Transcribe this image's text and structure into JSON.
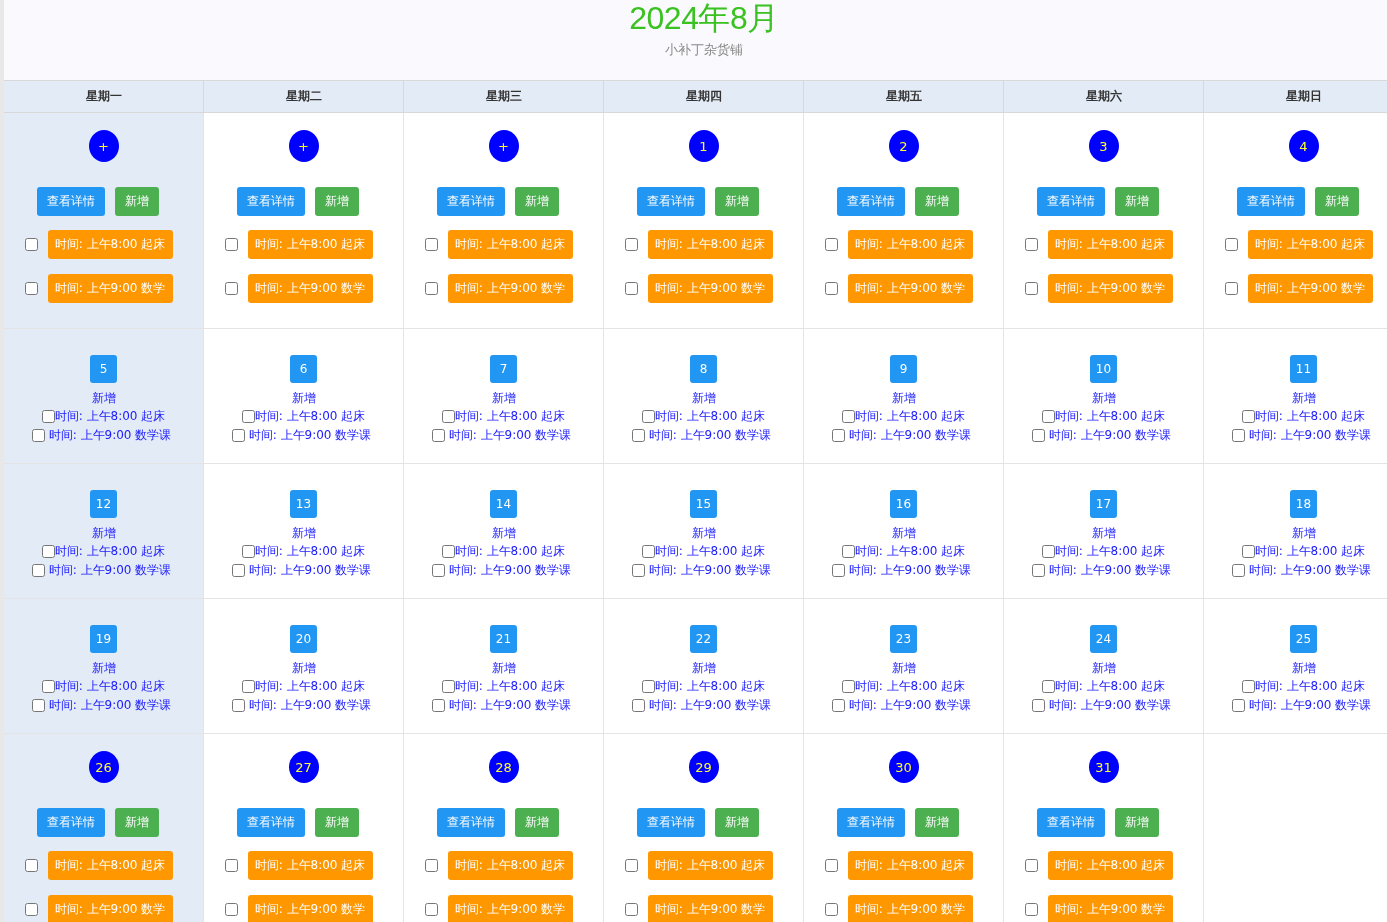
{
  "header": {
    "title": "2024年8月",
    "subtitle": "小补丁杂货铺"
  },
  "weekdays": [
    {
      "label": "星期一"
    },
    {
      "label": "星期二"
    },
    {
      "label": "星期三"
    },
    {
      "label": "星期四"
    },
    {
      "label": "星期五"
    },
    {
      "label": "星期六"
    },
    {
      "label": "星期日"
    }
  ],
  "weeks": [
    {
      "days": [
        {
          "kind": "full",
          "label": "+",
          "highlighted": true,
          "detail_button": "查看详情",
          "add_button": "新增",
          "events": [
            {
              "text": "时间: 上午8:00 起床",
              "checked": false
            },
            {
              "text": "时间: 上午9:00 数学",
              "checked": false
            }
          ]
        },
        {
          "kind": "full",
          "label": "+",
          "highlighted": false,
          "detail_button": "查看详情",
          "add_button": "新增",
          "events": [
            {
              "text": "时间: 上午8:00 起床",
              "checked": false
            },
            {
              "text": "时间: 上午9:00 数学",
              "checked": false
            }
          ]
        },
        {
          "kind": "full",
          "label": "+",
          "highlighted": false,
          "detail_button": "查看详情",
          "add_button": "新增",
          "events": [
            {
              "text": "时间: 上午8:00 起床",
              "checked": false
            },
            {
              "text": "时间: 上午9:00 数学",
              "checked": false
            }
          ]
        },
        {
          "kind": "full",
          "label": "1",
          "highlighted": false,
          "detail_button": "查看详情",
          "add_button": "新增",
          "events": [
            {
              "text": "时间: 上午8:00 起床",
              "checked": false
            },
            {
              "text": "时间: 上午9:00 数学",
              "checked": false
            }
          ]
        },
        {
          "kind": "full",
          "label": "2",
          "highlighted": false,
          "detail_button": "查看详情",
          "add_button": "新增",
          "events": [
            {
              "text": "时间: 上午8:00 起床",
              "checked": false
            },
            {
              "text": "时间: 上午9:00 数学",
              "checked": false
            }
          ]
        },
        {
          "kind": "full",
          "label": "3",
          "highlighted": false,
          "detail_button": "查看详情",
          "add_button": "新增",
          "events": [
            {
              "text": "时间: 上午8:00 起床",
              "checked": false
            },
            {
              "text": "时间: 上午9:00 数学",
              "checked": false
            }
          ]
        },
        {
          "kind": "full",
          "label": "4",
          "highlighted": false,
          "detail_button": "查看详情",
          "add_button": "新增",
          "events": [
            {
              "text": "时间: 上午8:00 起床",
              "checked": false
            },
            {
              "text": "时间: 上午9:00 数学",
              "checked": false
            }
          ]
        }
      ]
    },
    {
      "days": [
        {
          "kind": "compact",
          "label": "5",
          "highlighted": true,
          "add_button": "新增",
          "events": [
            {
              "text": "时间: 上午8:00 起床",
              "checked": false
            },
            {
              "text": "时间: 上午9:00 数学课",
              "checked": false
            }
          ]
        },
        {
          "kind": "compact",
          "label": "6",
          "highlighted": false,
          "add_button": "新增",
          "events": [
            {
              "text": "时间: 上午8:00 起床",
              "checked": false
            },
            {
              "text": "时间: 上午9:00 数学课",
              "checked": false
            }
          ]
        },
        {
          "kind": "compact",
          "label": "7",
          "highlighted": false,
          "add_button": "新增",
          "events": [
            {
              "text": "时间: 上午8:00 起床",
              "checked": false
            },
            {
              "text": "时间: 上午9:00 数学课",
              "checked": false
            }
          ]
        },
        {
          "kind": "compact",
          "label": "8",
          "highlighted": false,
          "add_button": "新增",
          "events": [
            {
              "text": "时间: 上午8:00 起床",
              "checked": false
            },
            {
              "text": "时间: 上午9:00 数学课",
              "checked": false
            }
          ]
        },
        {
          "kind": "compact",
          "label": "9",
          "highlighted": false,
          "add_button": "新增",
          "events": [
            {
              "text": "时间: 上午8:00 起床",
              "checked": false
            },
            {
              "text": "时间: 上午9:00 数学课",
              "checked": false
            }
          ]
        },
        {
          "kind": "compact",
          "label": "10",
          "highlighted": false,
          "add_button": "新增",
          "events": [
            {
              "text": "时间: 上午8:00 起床",
              "checked": false
            },
            {
              "text": "时间: 上午9:00 数学课",
              "checked": false
            }
          ]
        },
        {
          "kind": "compact",
          "label": "11",
          "highlighted": false,
          "add_button": "新增",
          "events": [
            {
              "text": "时间: 上午8:00 起床",
              "checked": false
            },
            {
              "text": "时间: 上午9:00 数学课",
              "checked": false
            }
          ]
        }
      ]
    },
    {
      "days": [
        {
          "kind": "compact",
          "label": "12",
          "highlighted": true,
          "add_button": "新增",
          "events": [
            {
              "text": "时间: 上午8:00 起床",
              "checked": false
            },
            {
              "text": "时间: 上午9:00 数学课",
              "checked": false
            }
          ]
        },
        {
          "kind": "compact",
          "label": "13",
          "highlighted": false,
          "add_button": "新增",
          "events": [
            {
              "text": "时间: 上午8:00 起床",
              "checked": false
            },
            {
              "text": "时间: 上午9:00 数学课",
              "checked": false
            }
          ]
        },
        {
          "kind": "compact",
          "label": "14",
          "highlighted": false,
          "add_button": "新增",
          "events": [
            {
              "text": "时间: 上午8:00 起床",
              "checked": false
            },
            {
              "text": "时间: 上午9:00 数学课",
              "checked": false
            }
          ]
        },
        {
          "kind": "compact",
          "label": "15",
          "highlighted": false,
          "add_button": "新增",
          "events": [
            {
              "text": "时间: 上午8:00 起床",
              "checked": false
            },
            {
              "text": "时间: 上午9:00 数学课",
              "checked": false
            }
          ]
        },
        {
          "kind": "compact",
          "label": "16",
          "highlighted": false,
          "add_button": "新增",
          "events": [
            {
              "text": "时间: 上午8:00 起床",
              "checked": false
            },
            {
              "text": "时间: 上午9:00 数学课",
              "checked": false
            }
          ]
        },
        {
          "kind": "compact",
          "label": "17",
          "highlighted": false,
          "add_button": "新增",
          "events": [
            {
              "text": "时间: 上午8:00 起床",
              "checked": false
            },
            {
              "text": "时间: 上午9:00 数学课",
              "checked": false
            }
          ]
        },
        {
          "kind": "compact",
          "label": "18",
          "highlighted": false,
          "add_button": "新增",
          "events": [
            {
              "text": "时间: 上午8:00 起床",
              "checked": false
            },
            {
              "text": "时间: 上午9:00 数学课",
              "checked": false
            }
          ]
        }
      ]
    },
    {
      "days": [
        {
          "kind": "compact",
          "label": "19",
          "highlighted": true,
          "add_button": "新增",
          "events": [
            {
              "text": "时间: 上午8:00 起床",
              "checked": false
            },
            {
              "text": "时间: 上午9:00 数学课",
              "checked": false
            }
          ]
        },
        {
          "kind": "compact",
          "label": "20",
          "highlighted": false,
          "add_button": "新增",
          "events": [
            {
              "text": "时间: 上午8:00 起床",
              "checked": false
            },
            {
              "text": "时间: 上午9:00 数学课",
              "checked": false
            }
          ]
        },
        {
          "kind": "compact",
          "label": "21",
          "highlighted": false,
          "add_button": "新增",
          "events": [
            {
              "text": "时间: 上午8:00 起床",
              "checked": false
            },
            {
              "text": "时间: 上午9:00 数学课",
              "checked": false
            }
          ]
        },
        {
          "kind": "compact",
          "label": "22",
          "highlighted": false,
          "add_button": "新增",
          "events": [
            {
              "text": "时间: 上午8:00 起床",
              "checked": false
            },
            {
              "text": "时间: 上午9:00 数学课",
              "checked": false
            }
          ]
        },
        {
          "kind": "compact",
          "label": "23",
          "highlighted": false,
          "add_button": "新增",
          "events": [
            {
              "text": "时间: 上午8:00 起床",
              "checked": false
            },
            {
              "text": "时间: 上午9:00 数学课",
              "checked": false
            }
          ]
        },
        {
          "kind": "compact",
          "label": "24",
          "highlighted": false,
          "add_button": "新增",
          "events": [
            {
              "text": "时间: 上午8:00 起床",
              "checked": false
            },
            {
              "text": "时间: 上午9:00 数学课",
              "checked": false
            }
          ]
        },
        {
          "kind": "compact",
          "label": "25",
          "highlighted": false,
          "add_button": "新增",
          "events": [
            {
              "text": "时间: 上午8:00 起床",
              "checked": false
            },
            {
              "text": "时间: 上午9:00 数学课",
              "checked": false
            }
          ]
        }
      ]
    },
    {
      "days": [
        {
          "kind": "full",
          "label": "26",
          "highlighted": true,
          "detail_button": "查看详情",
          "add_button": "新增",
          "events": [
            {
              "text": "时间: 上午8:00 起床",
              "checked": false
            },
            {
              "text": "时间: 上午9:00 数学",
              "checked": false
            }
          ]
        },
        {
          "kind": "full",
          "label": "27",
          "highlighted": false,
          "detail_button": "查看详情",
          "add_button": "新增",
          "events": [
            {
              "text": "时间: 上午8:00 起床",
              "checked": false
            },
            {
              "text": "时间: 上午9:00 数学",
              "checked": false
            }
          ]
        },
        {
          "kind": "full",
          "label": "28",
          "highlighted": false,
          "detail_button": "查看详情",
          "add_button": "新增",
          "events": [
            {
              "text": "时间: 上午8:00 起床",
              "checked": false
            },
            {
              "text": "时间: 上午9:00 数学",
              "checked": false
            }
          ]
        },
        {
          "kind": "full",
          "label": "29",
          "highlighted": false,
          "detail_button": "查看详情",
          "add_button": "新增",
          "events": [
            {
              "text": "时间: 上午8:00 起床",
              "checked": false
            },
            {
              "text": "时间: 上午9:00 数学",
              "checked": false
            }
          ]
        },
        {
          "kind": "full",
          "label": "30",
          "highlighted": false,
          "detail_button": "查看详情",
          "add_button": "新增",
          "events": [
            {
              "text": "时间: 上午8:00 起床",
              "checked": false
            },
            {
              "text": "时间: 上午9:00 数学",
              "checked": false
            }
          ]
        },
        {
          "kind": "full",
          "label": "31",
          "highlighted": false,
          "detail_button": "查看详情",
          "add_button": "新增",
          "events": [
            {
              "text": "时间: 上午8:00 起床",
              "checked": false
            },
            {
              "text": "时间: 上午9:00 数学",
              "checked": false
            }
          ]
        },
        {
          "kind": "empty"
        }
      ]
    }
  ]
}
